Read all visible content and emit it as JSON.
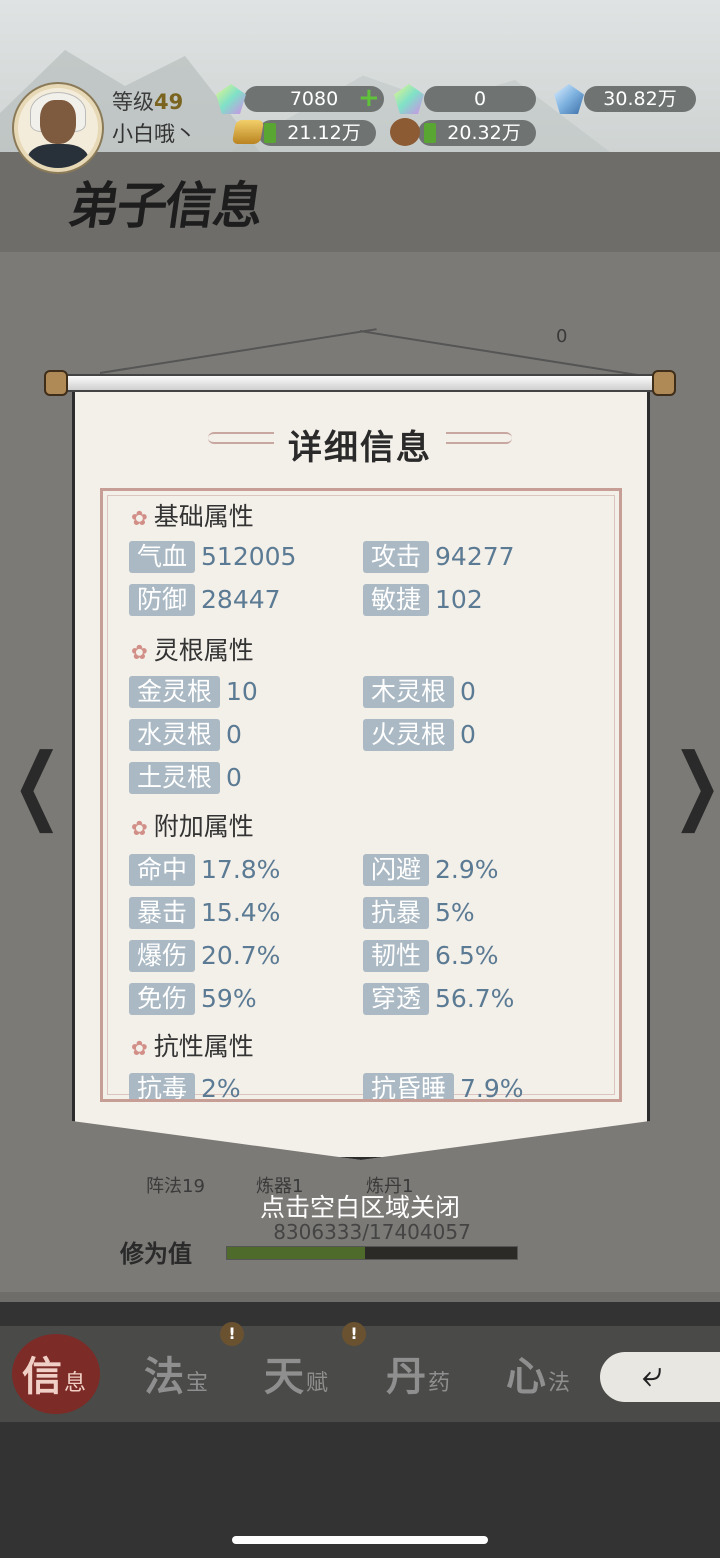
{
  "header": {
    "level_label": "等级",
    "level_value": "49",
    "username": "小白哦丶",
    "resources": {
      "jade": "7080",
      "bound_jade": "0",
      "crystal": "30.82万",
      "gold": "21.12万",
      "wood": "20.32万"
    }
  },
  "page_title": "弟子信息",
  "modal": {
    "title": "详细信息",
    "sections": {
      "basic": "基础属性",
      "spirit": "灵根属性",
      "extra": "附加属性",
      "resist": "抗性属性"
    },
    "basic": {
      "hp_label": "气血",
      "hp": "512005",
      "atk_label": "攻击",
      "atk": "94277",
      "def_label": "防御",
      "def": "28447",
      "agi_label": "敏捷",
      "agi": "102"
    },
    "spirit": {
      "metal_label": "金灵根",
      "metal": "10",
      "wood_label": "木灵根",
      "wood": "0",
      "water_label": "水灵根",
      "water": "0",
      "fire_label": "火灵根",
      "fire": "0",
      "earth_label": "土灵根",
      "earth": "0"
    },
    "extra": {
      "hit_label": "命中",
      "hit": "17.8%",
      "dodge_label": "闪避",
      "dodge": "2.9%",
      "crit_label": "暴击",
      "crit": "15.4%",
      "anticrit_label": "抗暴",
      "anticrit": "5%",
      "critdmg_label": "爆伤",
      "critdmg": "20.7%",
      "tough_label": "韧性",
      "tough": "6.5%",
      "dmgred_label": "免伤",
      "dmgred": "59%",
      "pierce_label": "穿透",
      "pierce": "56.7%"
    },
    "resist": {
      "poison_label": "抗毒",
      "poison": "2%",
      "sleep_label": "抗昏睡",
      "sleep": "7.9%"
    },
    "close_hint": "点击空白区域关闭"
  },
  "background": {
    "skills": [
      "阵法19",
      "炼器1",
      "炼丹1"
    ],
    "xp_label": "修为值",
    "xp_text": "8306333/17404057",
    "xp_fraction": 0.477,
    "count": "0"
  },
  "bottom_nav": [
    {
      "big": "信",
      "small": "息"
    },
    {
      "big": "法",
      "small": "宝"
    },
    {
      "big": "天",
      "small": "赋"
    },
    {
      "big": "丹",
      "small": "药"
    },
    {
      "big": "心",
      "small": "法"
    }
  ],
  "alert_mark": "!"
}
